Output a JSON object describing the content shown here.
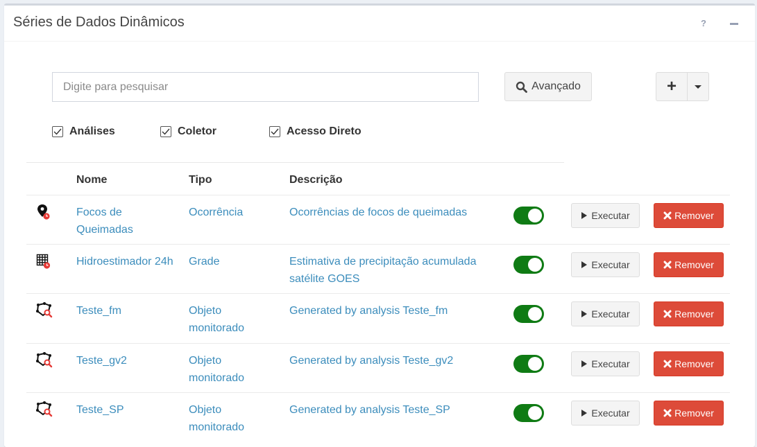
{
  "panel": {
    "title": "Séries de Dados Dinâmicos",
    "help_label": "?"
  },
  "search": {
    "placeholder": "Digite para pesquisar",
    "value": "",
    "advanced_label": "Avançado",
    "add_label": "+"
  },
  "filters": [
    {
      "label": "Análises",
      "checked": true
    },
    {
      "label": "Coletor",
      "checked": true
    },
    {
      "label": "Acesso Direto",
      "checked": true
    }
  ],
  "table": {
    "headers": {
      "name": "Nome",
      "type": "Tipo",
      "description": "Descrição"
    },
    "rows": [
      {
        "icon": "map-marker-clock-icon",
        "name": "Focos de Queimadas",
        "type": "Ocorrência",
        "description": "Ocorrências de focos de queimadas",
        "active": true,
        "execute_label": "Executar",
        "remove_label": "Remover"
      },
      {
        "icon": "grid-clock-icon",
        "name": "Hidroestimador 24h",
        "type": "Grade",
        "description": "Estimativa de precipitação acumulada satélite GOES",
        "active": true,
        "execute_label": "Executar",
        "remove_label": "Remover"
      },
      {
        "icon": "polygon-search-icon",
        "name": "Teste_fm",
        "type": "Objeto monitorado",
        "description": "Generated by analysis Teste_fm",
        "active": true,
        "execute_label": "Executar",
        "remove_label": "Remover"
      },
      {
        "icon": "polygon-search-icon",
        "name": "Teste_gv2",
        "type": "Objeto monitorado",
        "description": "Generated by analysis Teste_gv2",
        "active": true,
        "execute_label": "Executar",
        "remove_label": "Remover"
      },
      {
        "icon": "polygon-search-icon",
        "name": "Teste_SP",
        "type": "Objeto monitorado",
        "description": "Generated by analysis Teste_SP",
        "active": true,
        "execute_label": "Executar",
        "remove_label": "Remover"
      }
    ]
  },
  "colors": {
    "link": "#3c8dbc",
    "toggle_on": "#0f7b14",
    "danger": "#dd4b39",
    "badge_red": "#e53935"
  }
}
